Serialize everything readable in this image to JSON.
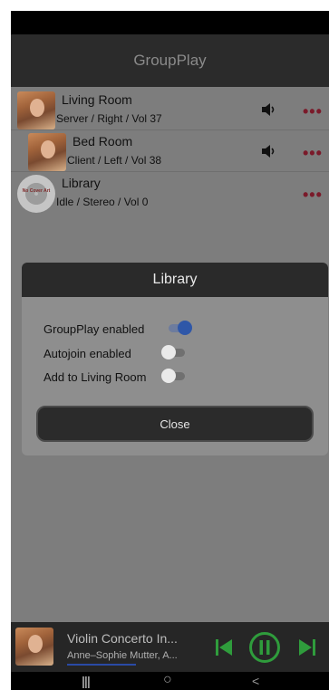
{
  "app": {
    "title": "GroupPlay"
  },
  "rooms": [
    {
      "name": "Living Room",
      "status": "Server / Right / Vol 37",
      "cover": "album-cover-icon",
      "has_volume": true
    },
    {
      "name": "Bed Room",
      "status": "Client / Left / Vol 38",
      "cover": "album-cover-icon",
      "has_volume": true
    },
    {
      "name": "Library",
      "status": "Idle / Stereo / Vol 0",
      "cover": "no-cover-disc-icon",
      "cover_text": "No Cover Art",
      "has_volume": false
    }
  ],
  "dialog": {
    "title": "Library",
    "options": [
      {
        "label": "GroupPlay enabled",
        "on": true
      },
      {
        "label": "Autojoin enabled",
        "on": false
      },
      {
        "label": "Add to Living Room",
        "on": false
      }
    ],
    "close_label": "Close"
  },
  "now_playing": {
    "title": "Violin Concerto In...",
    "artist": "Anne–Sophie Mutter, A...",
    "progress": 0.35,
    "accent_color": "#2f9c3c"
  },
  "nav": {
    "recents": "|||",
    "home": "○",
    "back": "<"
  },
  "colors": {
    "accent": "#2f57a8",
    "dots": "#7a1a2a"
  }
}
